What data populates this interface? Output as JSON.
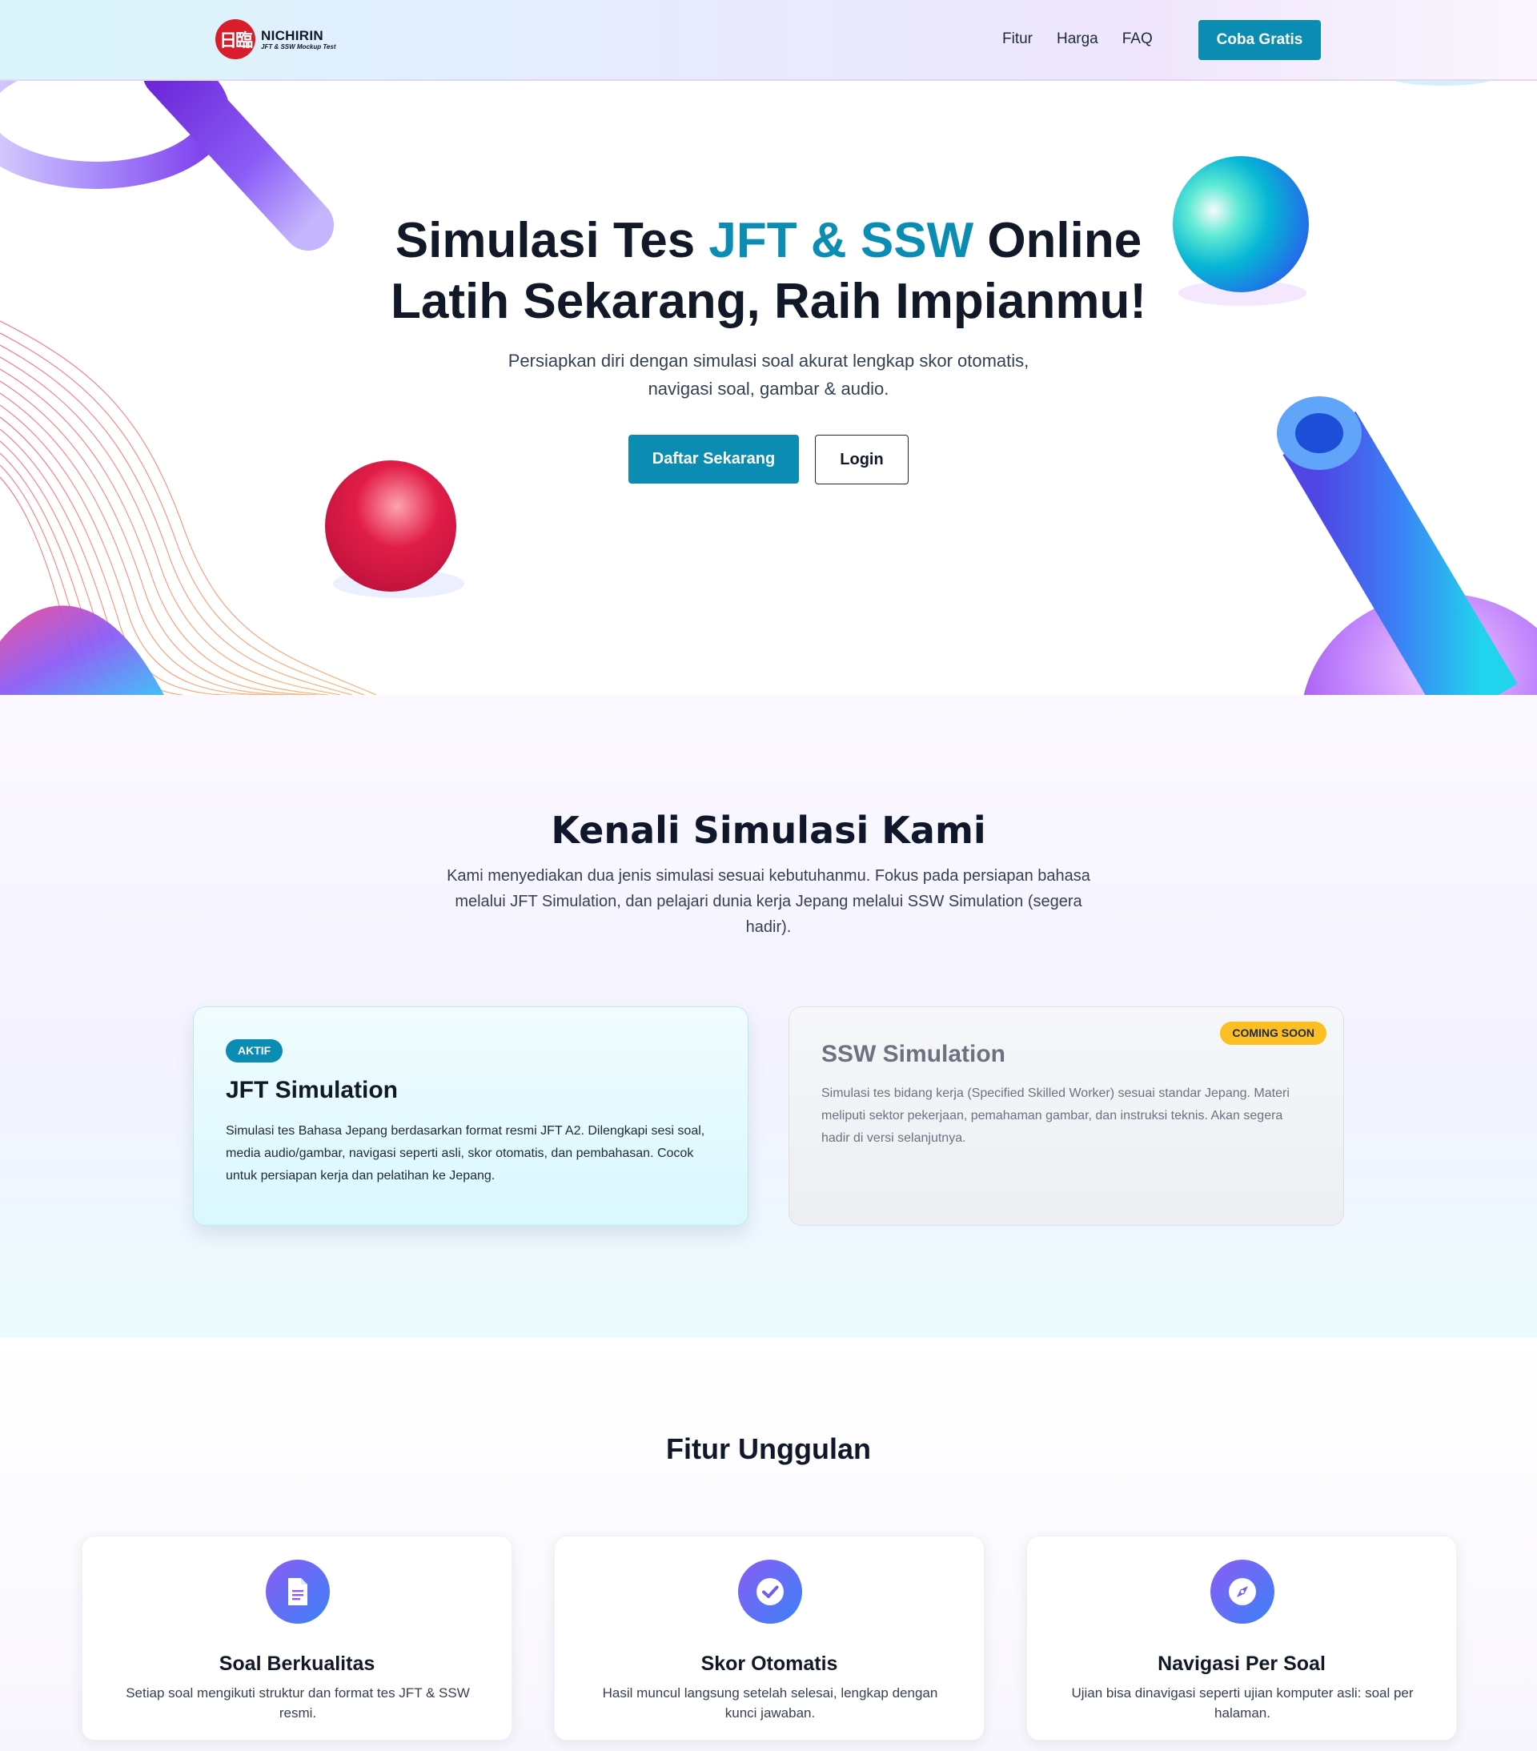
{
  "brand": {
    "logo_glyph": "日臨",
    "name": "NICHIRIN",
    "tagline": "JFT & SSW Mockup Test"
  },
  "nav": {
    "links": [
      "Fitur",
      "Harga",
      "FAQ"
    ],
    "cta": "Coba Gratis"
  },
  "hero": {
    "title_line1_pre": "Simulasi Tes ",
    "title_line1_accent": "JFT & SSW",
    "title_line1_post": " Online",
    "title_line2": "Latih Sekarang, Raih Impianmu!",
    "subtitle": "Persiapkan diri dengan simulasi soal akurat lengkap skor otomatis, navigasi soal, gambar & audio.",
    "primary_button": "Daftar Sekarang",
    "secondary_button": "Login"
  },
  "simulations": {
    "title": "Kenali Simulasi Kami",
    "subtitle": "Kami menyediakan dua jenis simulasi sesuai kebutuhanmu. Fokus pada persiapan bahasa melalui JFT Simulation, dan pelajari dunia kerja Jepang melalui SSW Simulation (segera hadir).",
    "cards": [
      {
        "badge": "AKTIF",
        "title": "JFT Simulation",
        "description": "Simulasi tes Bahasa Jepang berdasarkan format resmi JFT A2. Dilengkapi sesi soal, media audio/gambar, navigasi seperti asli, skor otomatis, dan pembahasan. Cocok untuk persiapan kerja dan pelatihan ke Jepang."
      },
      {
        "badge": "COMING SOON",
        "title": "SSW Simulation",
        "description": "Simulasi tes bidang kerja (Specified Skilled Worker) sesuai standar Jepang. Materi meliputi sektor pekerjaan, pemahaman gambar, dan instruksi teknis. Akan segera hadir di versi selanjutnya."
      }
    ]
  },
  "features": {
    "title": "Fitur Unggulan",
    "items": [
      {
        "icon": "document-icon",
        "title": "Soal Berkualitas",
        "description": "Setiap soal mengikuti struktur dan format tes JFT & SSW resmi."
      },
      {
        "icon": "check-circle-icon",
        "title": "Skor Otomatis",
        "description": "Hasil muncul langsung setelah selesai, lengkap dengan kunci jawaban."
      },
      {
        "icon": "compass-icon",
        "title": "Navigasi Per Soal",
        "description": "Ujian bisa dinavigasi seperti ujian komputer asli: soal per halaman."
      }
    ]
  },
  "colors": {
    "primary": "#0b8db3",
    "coming_soon": "#fbbf24",
    "logo_red": "#d81d2d",
    "text_dark": "#0f172a"
  }
}
